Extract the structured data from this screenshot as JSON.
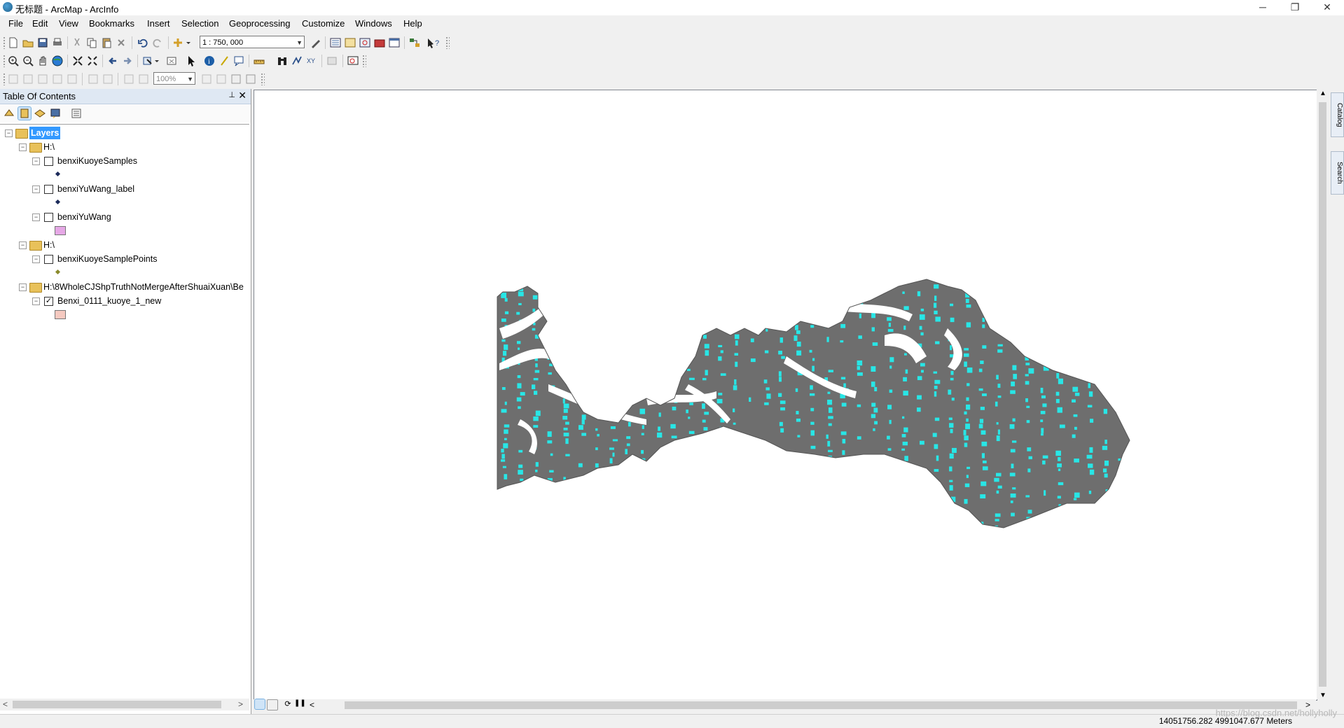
{
  "window": {
    "title": "无标题 - ArcMap - ArcInfo",
    "minimize": "─",
    "restore": "❐",
    "close": "✕"
  },
  "menu": [
    "File",
    "Edit",
    "View",
    "Bookmarks",
    "Insert",
    "Selection",
    "Geoprocessing",
    "Customize",
    "Windows",
    "Help"
  ],
  "toolbar": {
    "scale": "1 : 750, 000",
    "zoom_percent": "100%"
  },
  "toc": {
    "title": "Table Of Contents",
    "pin": "⊥",
    "close": "✕",
    "root": "Layers",
    "items": [
      {
        "type": "folder",
        "label": "H:\\"
      },
      {
        "type": "layer",
        "label": "benxiKuoyeSamples",
        "checked": false,
        "symbol": "point"
      },
      {
        "type": "layer",
        "label": "benxiYuWang_label",
        "checked": false,
        "symbol": "point"
      },
      {
        "type": "layer",
        "label": "benxiYuWang",
        "checked": false,
        "symbol": "polygon",
        "color": "#e6a8e6"
      },
      {
        "type": "folder",
        "label": "H:\\"
      },
      {
        "type": "layer",
        "label": "benxiKuoyeSamplePoints",
        "checked": false,
        "symbol": "point",
        "color": "#8a8a2a"
      },
      {
        "type": "folder",
        "label": "H:\\8WholeCJShpTruthNotMergeAfterShuaiXuan\\Be"
      },
      {
        "type": "layer",
        "label": "Benxi_0111_kuoye_1_new",
        "checked": true,
        "symbol": "polygon",
        "color": "#f5c9c0"
      }
    ]
  },
  "map": {
    "region_color": "#6e6e6e",
    "sample_color": "#28e6e6",
    "gap_color": "#ffffff"
  },
  "side_tabs": [
    "Catalog",
    "Search"
  ],
  "status": {
    "coordinates": "14051756.282  4991047.677 Meters"
  },
  "watermark": "https://blog.csdn.net/hollyholly"
}
